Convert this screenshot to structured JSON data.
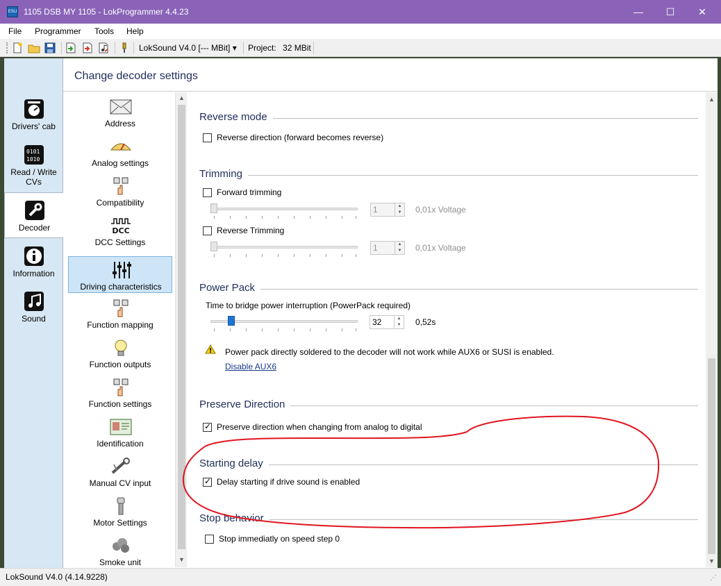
{
  "window": {
    "app_icon_text": "ESU",
    "title": "1105 DSB MY 1105 - LokProgrammer 4.4.23",
    "minimize": "—",
    "maximize": "☐",
    "close": "✕"
  },
  "menu": {
    "items": [
      "File",
      "Programmer",
      "Tools",
      "Help"
    ]
  },
  "toolbar": {
    "icons": [
      "new-file-icon",
      "open-folder-icon",
      "save-icon",
      "read-icon",
      "write-icon",
      "sound-write-icon",
      "connect-icon"
    ],
    "device_combo": "LokSound V4.0 [--- MBit] ▾",
    "project_label": "Project:",
    "project_value": "32 MBit"
  },
  "leftnav": {
    "items": [
      {
        "label": "Drivers' cab",
        "icon": "drivers-cab-icon"
      },
      {
        "label": "Read / Write CVs",
        "icon": "read-write-cvs-icon"
      },
      {
        "label": "Decoder",
        "icon": "decoder-wrench-icon"
      },
      {
        "label": "Information",
        "icon": "information-icon"
      },
      {
        "label": "Sound",
        "icon": "sound-note-icon"
      }
    ]
  },
  "panel": {
    "title": "Change decoder settings"
  },
  "categories": [
    {
      "label": "Address",
      "icon": "envelope-icon"
    },
    {
      "label": "Analog settings",
      "icon": "gauge-icon"
    },
    {
      "label": "Compatibility",
      "icon": "compatibility-icon"
    },
    {
      "label": "DCC Settings",
      "icon": "dcc-icon",
      "icon_text": "DCC"
    },
    {
      "label": "Driving characteristics",
      "icon": "sliders-icon"
    },
    {
      "label": "Function mapping",
      "icon": "function-mapping-icon"
    },
    {
      "label": "Function outputs",
      "icon": "lightbulb-icon"
    },
    {
      "label": "Function settings",
      "icon": "function-settings-icon"
    },
    {
      "label": "Identification",
      "icon": "id-card-icon"
    },
    {
      "label": "Manual CV input",
      "icon": "manual-cv-icon"
    },
    {
      "label": "Motor Settings",
      "icon": "motor-icon"
    },
    {
      "label": "Smoke unit",
      "icon": "smoke-icon"
    }
  ],
  "content": {
    "reverse_mode": {
      "title": "Reverse mode",
      "reverse_direction": {
        "label": "Reverse direction (forward becomes reverse)",
        "checked": false
      }
    },
    "trimming": {
      "title": "Trimming",
      "forward": {
        "label": "Forward trimming",
        "checked": false,
        "value": "1",
        "unit": "0,01x Voltage"
      },
      "reverse": {
        "label": "Reverse Trimming",
        "checked": false,
        "value": "1",
        "unit": "0,01x Voltage"
      }
    },
    "power_pack": {
      "title": "Power Pack",
      "label": "Time to bridge power interruption (PowerPack required)",
      "value": "32",
      "unit": "0,52s",
      "warning": "Power pack directly soldered to the decoder will not work while AUX6 or SUSI is enabled.",
      "link": "Disable AUX6"
    },
    "preserve_direction": {
      "title": "Preserve Direction",
      "option": {
        "label": "Preserve direction when changing from analog to digital",
        "checked": true
      }
    },
    "starting_delay": {
      "title": "Starting delay",
      "option": {
        "label": "Delay starting if drive sound is enabled",
        "checked": true
      }
    },
    "stop_behavior": {
      "title": "Stop behavior",
      "option": {
        "label": "Stop immediatly on speed step 0",
        "checked": false
      }
    }
  },
  "status": {
    "text": "LokSound V4.0 (4.14.9228)"
  },
  "colors": {
    "titlebar": "#8a63b8",
    "accent_text": "#1f2d59",
    "selection": "#cde5f7",
    "annotation": "#e0141e"
  }
}
